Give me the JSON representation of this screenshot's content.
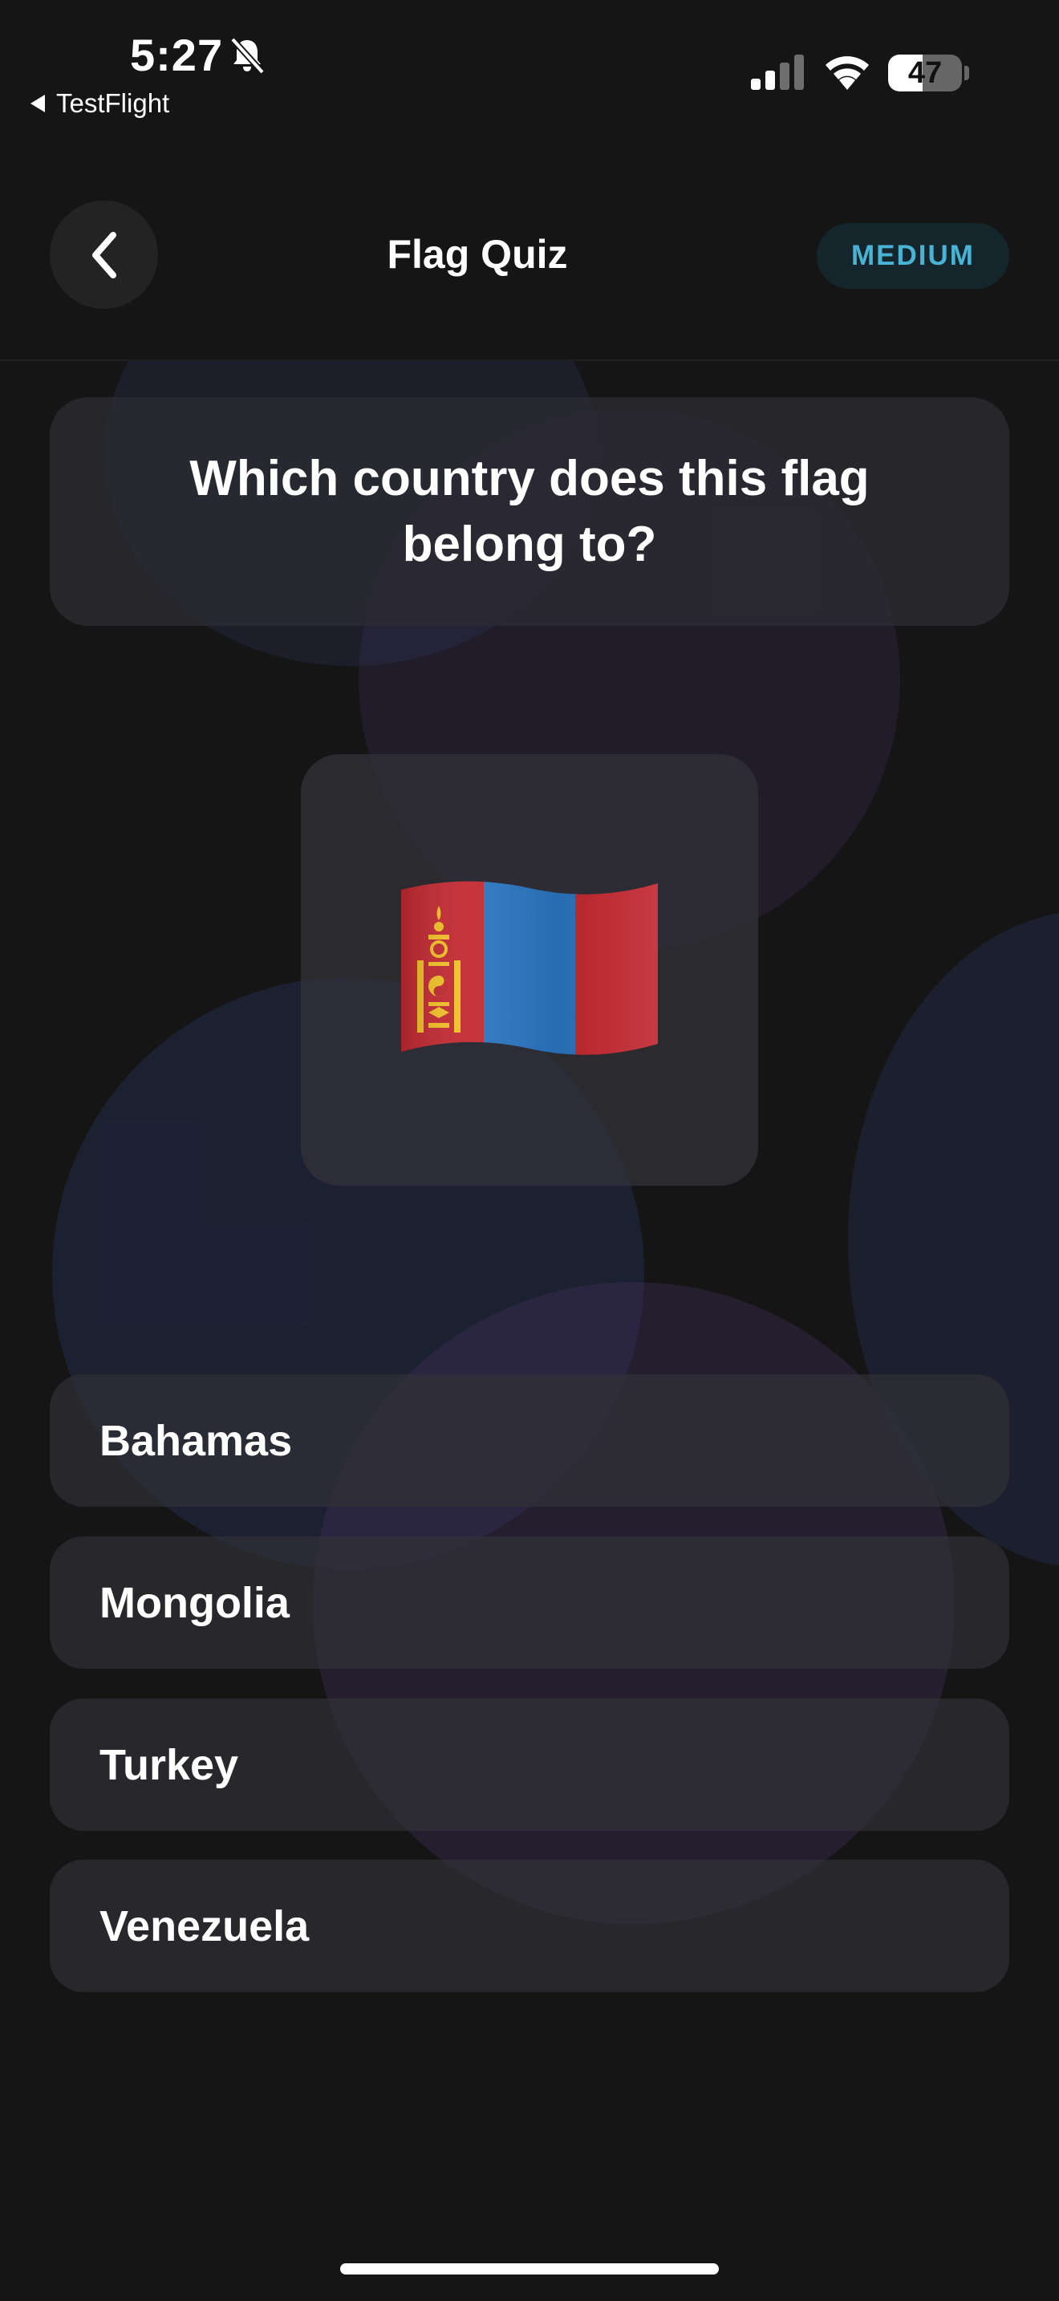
{
  "status_bar": {
    "time": "5:27",
    "back_app": "TestFlight",
    "battery_level": "47",
    "battery_fraction": 0.47,
    "icons": [
      "bell-slash-icon",
      "cellular-signal-icon",
      "wifi-icon",
      "battery-icon"
    ]
  },
  "header": {
    "title": "Flag Quiz",
    "difficulty": "MEDIUM",
    "back_icon": "chevron-left-icon"
  },
  "question": {
    "text": "Which country does this flag belong to?",
    "flag_icon": "mongolia-flag-icon"
  },
  "answers": [
    {
      "label": "Bahamas"
    },
    {
      "label": "Mongolia"
    },
    {
      "label": "Turkey"
    },
    {
      "label": "Venezuela"
    }
  ],
  "colors": {
    "background": "#151515",
    "card": "#2c2c32",
    "badge_text": "#49b3d6",
    "badge_bg": "#14262c",
    "flag_red": "#c4272f",
    "flag_blue": "#2a75c0",
    "flag_gold": "#f3c224"
  }
}
